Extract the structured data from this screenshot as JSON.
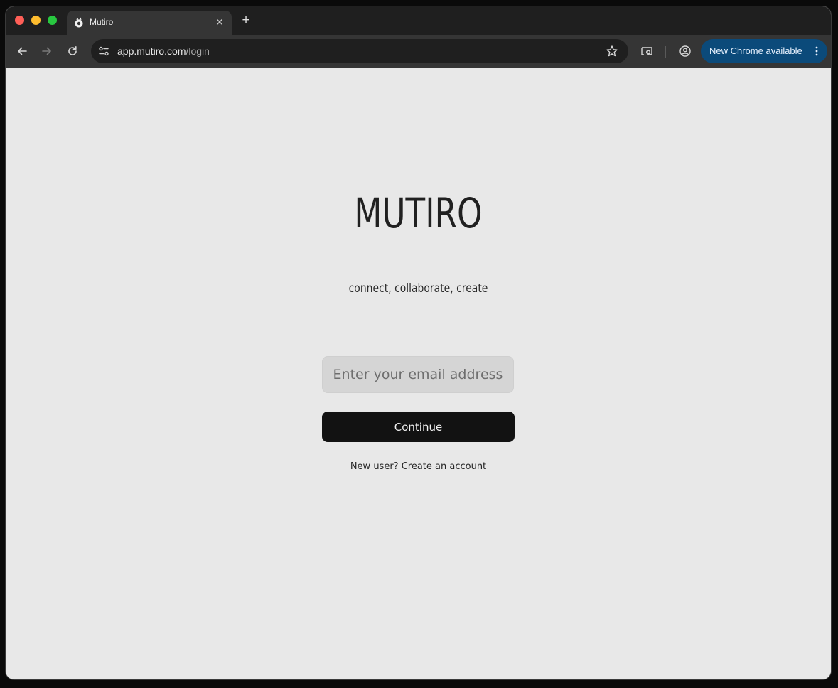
{
  "browser": {
    "tab": {
      "title": "Mutiro",
      "close_symbol": "✕"
    },
    "new_tab_symbol": "+",
    "url": {
      "host": "app.mutiro.com",
      "path": "/login"
    },
    "update_chip": {
      "label": "New Chrome available",
      "color": "#0b4a7a"
    }
  },
  "login": {
    "logo": "MUTIRO",
    "tagline": "connect, collaborate, create",
    "email_placeholder": "Enter your email address",
    "continue_label": "Continue",
    "signup_text": "New user? Create an account"
  },
  "colors": {
    "page_background": "#e8e8e8",
    "button_background": "#121212",
    "input_background": "#d5d5d5"
  },
  "icons": {
    "favicon": "mutiro-logo-icon",
    "back": "arrow-left-icon",
    "forward": "arrow-right-icon",
    "reload": "reload-icon",
    "site_info": "tune-icon",
    "bookmark": "star-icon",
    "tab_search": "tab-search-icon",
    "profile": "profile-icon",
    "menu": "kebab-menu-icon"
  }
}
